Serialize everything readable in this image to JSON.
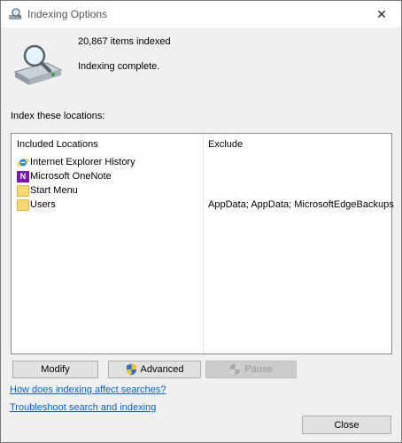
{
  "window": {
    "title": "Indexing Options",
    "close_glyph": "✕"
  },
  "stats": {
    "items_indexed": "20,867 items indexed",
    "status": "Indexing complete."
  },
  "locations": {
    "label": "Index these locations:",
    "columns": {
      "included": "Included Locations",
      "exclude": "Exclude"
    },
    "rows": [
      {
        "name": "Internet Explorer History",
        "icon": "ie-icon",
        "exclude": ""
      },
      {
        "name": "Microsoft OneNote",
        "icon": "onenote-icon",
        "exclude": ""
      },
      {
        "name": "Start Menu",
        "icon": "folder-icon",
        "exclude": ""
      },
      {
        "name": "Users",
        "icon": "folder-icon",
        "exclude": "AppData; AppData; MicrosoftEdgeBackups"
      }
    ]
  },
  "buttons": {
    "modify": "Modify",
    "advanced": "Advanced",
    "pause": "Pause",
    "close": "Close"
  },
  "links": {
    "how_affects": "How does indexing affect searches?",
    "troubleshoot": "Troubleshoot search and indexing"
  },
  "colors": {
    "link": "#0066cc",
    "window_bg": "#f0f0f0",
    "onenote": "#7719aa",
    "folder": "#f8d775"
  }
}
